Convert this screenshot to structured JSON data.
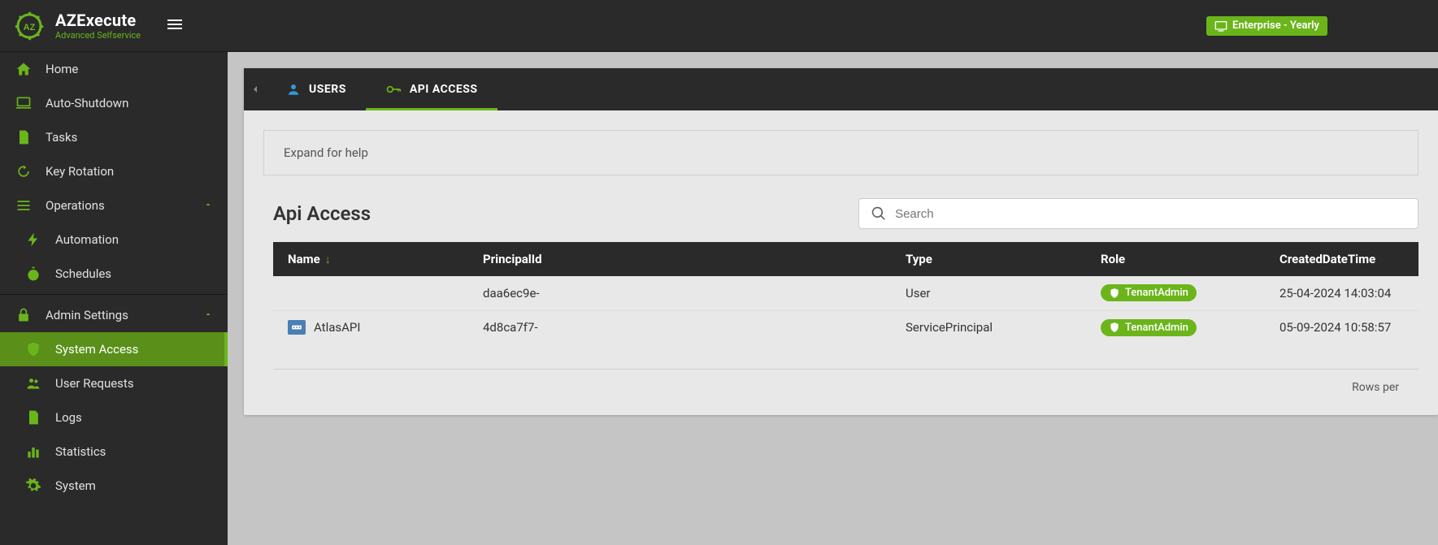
{
  "header": {
    "brand_title": "AZExecute",
    "brand_subtitle": "Advanced Selfservice",
    "plan_label": "Enterprise - Yearly"
  },
  "sidebar": {
    "items": [
      {
        "label": "Home",
        "icon": "home"
      },
      {
        "label": "Auto-Shutdown",
        "icon": "laptop"
      },
      {
        "label": "Tasks",
        "icon": "file"
      },
      {
        "label": "Key Rotation",
        "icon": "rotate"
      }
    ],
    "operations": {
      "label": "Operations",
      "items": [
        {
          "label": "Automation",
          "icon": "bolt"
        },
        {
          "label": "Schedules",
          "icon": "stopwatch"
        }
      ]
    },
    "admin": {
      "label": "Admin Settings",
      "items": [
        {
          "label": "System Access",
          "icon": "shield",
          "active": true
        },
        {
          "label": "User Requests",
          "icon": "users"
        },
        {
          "label": "Logs",
          "icon": "doc"
        },
        {
          "label": "Statistics",
          "icon": "chart"
        },
        {
          "label": "System",
          "icon": "gear"
        }
      ]
    }
  },
  "tabs": {
    "users": "USERS",
    "api": "API ACCESS"
  },
  "help": {
    "text": "Expand for help"
  },
  "page": {
    "title": "Api Access",
    "search_placeholder": "Search",
    "footer_label": "Rows per"
  },
  "table": {
    "columns": {
      "name": "Name",
      "principalId": "PrincipalId",
      "type": "Type",
      "role": "Role",
      "created": "CreatedDateTime"
    },
    "rows": [
      {
        "name": "",
        "principalId": "daa6ec9e-",
        "type": "User",
        "role": "TenantAdmin",
        "created": "25-04-2024 14:03:04",
        "hasIcon": false
      },
      {
        "name": "AtlasAPI",
        "principalId": "4d8ca7f7-",
        "type": "ServicePrincipal",
        "role": "TenantAdmin",
        "created": "05-09-2024 10:58:57",
        "hasIcon": true
      }
    ]
  }
}
